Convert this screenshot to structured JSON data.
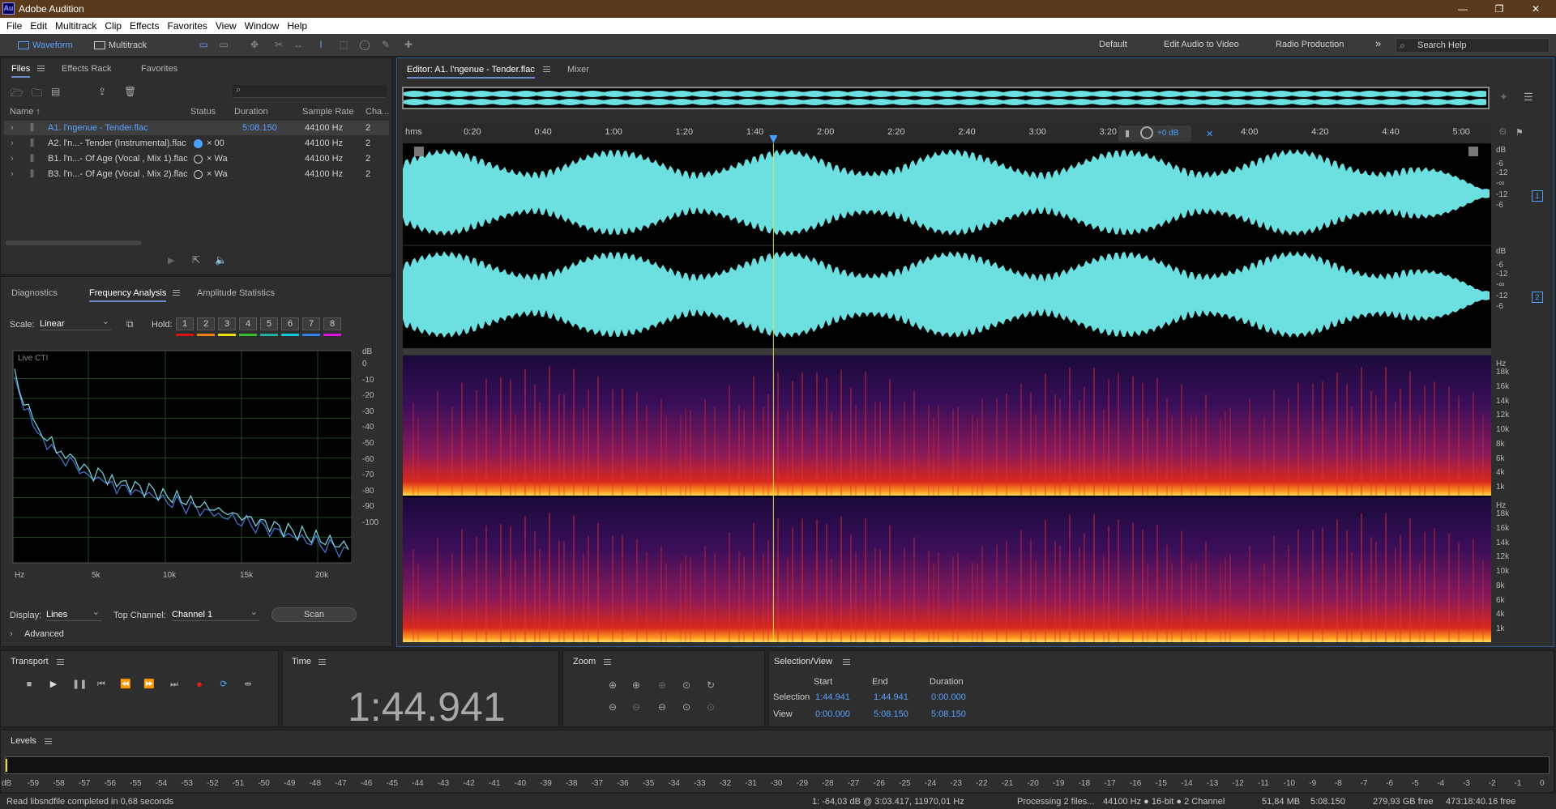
{
  "window": {
    "title": "Adobe Audition",
    "logo": "Au",
    "controls": [
      "—",
      "❐",
      "✕"
    ]
  },
  "menu": [
    "File",
    "Edit",
    "Multitrack",
    "Clip",
    "Effects",
    "Favorites",
    "View",
    "Window",
    "Help"
  ],
  "toolbar": {
    "modes": [
      {
        "label": "Waveform",
        "active": true
      },
      {
        "label": "Multitrack",
        "active": false
      }
    ],
    "workspaces": [
      "Default",
      "Edit Audio to Video",
      "Radio Production"
    ],
    "more": "»",
    "search_placeholder": "Search Help"
  },
  "files": {
    "tabs": [
      "Files",
      "Effects Rack",
      "Favorites"
    ],
    "columns": [
      "Name ↑",
      "Status",
      "Duration",
      "Sample Rate",
      "Cha..."
    ],
    "rows": [
      {
        "name": "A1. l'ngenue - Tender.flac",
        "status": "",
        "duration": "5:08.150",
        "rate": "44100 Hz",
        "ch": "2",
        "selected": true
      },
      {
        "name": "A2. l'n...- Tender (Instrumental).flac",
        "status": "× 00",
        "duration": "",
        "rate": "44100 Hz",
        "ch": "2",
        "selected": false
      },
      {
        "name": "B1. l'n...- Of Age (Vocal , Mix 1).flac",
        "status": "× Wa",
        "duration": "",
        "rate": "44100 Hz",
        "ch": "2",
        "selected": false
      },
      {
        "name": "B3. l'n...- Of Age (Vocal , Mix 2).flac",
        "status": "× Wa",
        "duration": "",
        "rate": "44100 Hz",
        "ch": "2",
        "selected": false
      }
    ]
  },
  "analysis": {
    "tabs": [
      "Diagnostics",
      "Frequency Analysis",
      "Amplitude Statistics"
    ],
    "scale_label": "Scale:",
    "scale_value": "Linear",
    "hold_label": "Hold:",
    "hold_buttons": [
      "1",
      "2",
      "3",
      "4",
      "5",
      "6",
      "7",
      "8"
    ],
    "hold_colors": [
      "#e01010",
      "#f08010",
      "#f0e010",
      "#30c030",
      "#20b0a0",
      "#10c8e0",
      "#3080f0",
      "#e010e0"
    ],
    "graph_label": "Live CTI",
    "db_unit": "dB",
    "db_ticks": [
      "0",
      "-10",
      "-20",
      "-30",
      "-40",
      "-50",
      "-60",
      "-70",
      "-80",
      "-90",
      "-100"
    ],
    "hz_ticks": [
      "Hz",
      "5k",
      "10k",
      "15k",
      "20k"
    ],
    "display_label": "Display:",
    "display_value": "Lines",
    "top_channel_label": "Top Channel:",
    "top_channel_value": "Channel 1",
    "scan_label": "Scan",
    "advanced_label": "Advanced",
    "spectrum_db": [
      -5,
      -15,
      -25,
      -22,
      -30,
      -36,
      -38,
      -42,
      -40,
      -46,
      -48,
      -50,
      -47,
      -52,
      -55,
      -53,
      -57,
      -60,
      -56,
      -58,
      -62,
      -60,
      -64,
      -61,
      -63,
      -66,
      -62,
      -65,
      -68,
      -64,
      -66,
      -70,
      -67,
      -69,
      -72,
      -68,
      -71,
      -74,
      -70,
      -73,
      -76,
      -72,
      -75,
      -78,
      -74,
      -77,
      -80,
      -76,
      -79,
      -82,
      -78,
      -81,
      -84,
      -80,
      -83,
      -86,
      -82,
      -85,
      -88,
      -84,
      -87,
      -90,
      -86,
      -89,
      -92,
      -88,
      -91,
      -94,
      -90,
      -93,
      -96,
      -92,
      -95
    ],
    "spectrum_max_hz": 22050
  },
  "editor": {
    "tabs": [
      "Editor: A1. l'ngenue - Tender.flac",
      "Mixer"
    ],
    "ruler": {
      "unit": "hms",
      "ticks": [
        "0:20",
        "0:40",
        "1:00",
        "1:20",
        "1:40",
        "2:00",
        "2:20",
        "2:40",
        "3:00",
        "3:20",
        "4:00",
        "4:20",
        "4:40",
        "5:00"
      ]
    },
    "hud_gain": "+0 dB",
    "channels": [
      "1",
      "2"
    ],
    "wave_db_labels": [
      "dB",
      "-6",
      "-12",
      "-∞",
      "-12",
      "-6"
    ],
    "spec_hz_labels": [
      "Hz",
      "18k",
      "16k",
      "14k",
      "12k",
      "10k",
      "8k",
      "6k",
      "4k",
      "1k"
    ],
    "duration_seconds": 308.15,
    "playhead_seconds": 104.941
  },
  "transport": {
    "title": "Transport"
  },
  "time": {
    "title": "Time",
    "display": "1:44.941"
  },
  "zoom": {
    "title": "Zoom"
  },
  "selection": {
    "title": "Selection/View",
    "cols": [
      "Start",
      "End",
      "Duration"
    ],
    "rows": [
      {
        "label": "Selection",
        "start": "1:44.941",
        "end": "1:44.941",
        "duration": "0:00.000"
      },
      {
        "label": "View",
        "start": "0:00.000",
        "end": "5:08.150",
        "duration": "5:08.150"
      }
    ]
  },
  "levels": {
    "title": "Levels",
    "scale": [
      "dB",
      "-59",
      "-58",
      "-57",
      "-56",
      "-55",
      "-54",
      "-53",
      "-52",
      "-51",
      "-50",
      "-49",
      "-48",
      "-47",
      "-46",
      "-45",
      "-44",
      "-43",
      "-42",
      "-41",
      "-40",
      "-39",
      "-38",
      "-37",
      "-36",
      "-35",
      "-34",
      "-33",
      "-32",
      "-31",
      "-30",
      "-29",
      "-28",
      "-27",
      "-26",
      "-25",
      "-24",
      "-23",
      "-22",
      "-21",
      "-20",
      "-19",
      "-18",
      "-17",
      "-16",
      "-15",
      "-14",
      "-13",
      "-12",
      "-11",
      "-10",
      "-9",
      "-8",
      "-7",
      "-6",
      "-5",
      "-4",
      "-3",
      "-2",
      "-1",
      "0"
    ]
  },
  "status": {
    "left": "Read libsndfile completed in 0,68 seconds",
    "cursor": "1: -64,03 dB @ 3:03.417, 11970,01 Hz",
    "processing": "Processing 2 files...",
    "format": "44100 Hz ● 16-bit ● 2 Channel",
    "size": "51,84 MB",
    "duration": "5:08.150",
    "free": "279,93 GB free",
    "time_free": "473:18:40.16 free"
  }
}
